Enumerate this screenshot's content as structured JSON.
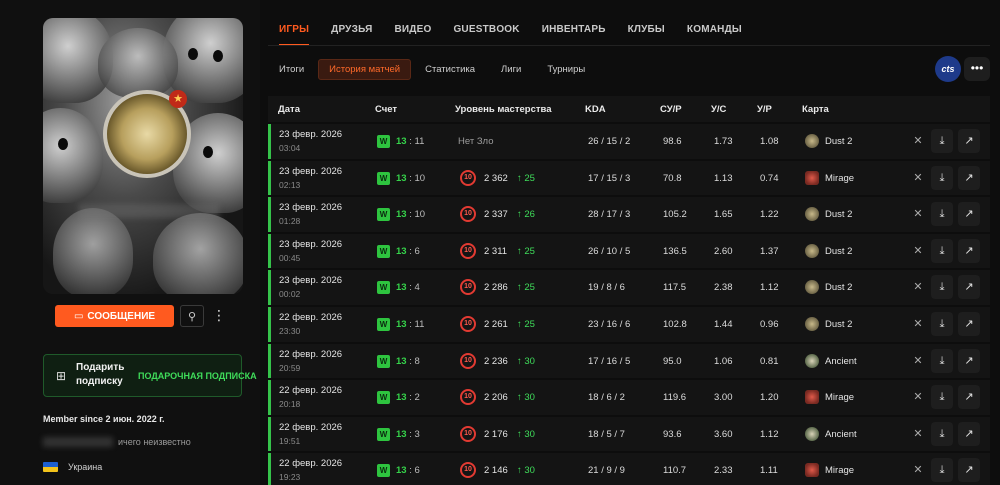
{
  "profile": {
    "message_button": "СООБЩЕНИЕ",
    "gift_title": "Подарить подписку",
    "gift_link": "ПОДАРОЧНАЯ ПОДПИСКА",
    "member_since": "Member since 2 июн. 2022 г.",
    "unknown_text": "ичего неизвестно",
    "country": "Украина"
  },
  "nav": {
    "tabs": [
      "ИГРЫ",
      "ДРУЗЬЯ",
      "ВИДЕО",
      "GUESTBOOK",
      "ИНВЕНТАРЬ",
      "КЛУБЫ",
      "КОМАНДЫ"
    ],
    "active_tab": "ИГРЫ",
    "subtabs": [
      "Итоги",
      "История матчей",
      "Статистика",
      "Лиги",
      "Турниры"
    ],
    "active_subtab": "История матчей",
    "cts_label": "cts",
    "more_label": "•••"
  },
  "table": {
    "headers": {
      "date": "Дата",
      "score": "Счет",
      "skill": "Уровень мастерства",
      "kda": "KDA",
      "adr": "СУ/Р",
      "kr": "У/С",
      "kd": "У/Р",
      "map": "Карта"
    },
    "rows": [
      {
        "date": "23 февр. 2026",
        "time": "03:04",
        "result": "W",
        "score_w": "13",
        "score_l": "11",
        "elo": "",
        "gain": "",
        "elo_text": "Нет Зло",
        "kda": "26 / 15 / 2",
        "adr": "98.6",
        "kr": "1.73",
        "kd": "1.08",
        "map": "Dust 2",
        "map_type": "dust"
      },
      {
        "date": "23 февр. 2026",
        "time": "02:13",
        "result": "W",
        "score_w": "13",
        "score_l": "10",
        "elo": "2 362",
        "gain": "↑ 25",
        "elo_text": "",
        "kda": "17 / 15 / 3",
        "adr": "70.8",
        "kr": "1.13",
        "kd": "0.74",
        "map": "Mirage",
        "map_type": "mirage"
      },
      {
        "date": "23 февр. 2026",
        "time": "01:28",
        "result": "W",
        "score_w": "13",
        "score_l": "10",
        "elo": "2 337",
        "gain": "↑ 26",
        "elo_text": "",
        "kda": "28 / 17 / 3",
        "adr": "105.2",
        "kr": "1.65",
        "kd": "1.22",
        "map": "Dust 2",
        "map_type": "dust"
      },
      {
        "date": "23 февр. 2026",
        "time": "00:45",
        "result": "W",
        "score_w": "13",
        "score_l": "6",
        "elo": "2 311",
        "gain": "↑ 25",
        "elo_text": "",
        "kda": "26 / 10 / 5",
        "adr": "136.5",
        "kr": "2.60",
        "kd": "1.37",
        "map": "Dust 2",
        "map_type": "dust"
      },
      {
        "date": "23 февр. 2026",
        "time": "00:02",
        "result": "W",
        "score_w": "13",
        "score_l": "4",
        "elo": "2 286",
        "gain": "↑ 25",
        "elo_text": "",
        "kda": "19 / 8 / 6",
        "adr": "117.5",
        "kr": "2.38",
        "kd": "1.12",
        "map": "Dust 2",
        "map_type": "dust"
      },
      {
        "date": "22 февр. 2026",
        "time": "23:30",
        "result": "W",
        "score_w": "13",
        "score_l": "11",
        "elo": "2 261",
        "gain": "↑ 25",
        "elo_text": "",
        "kda": "23 / 16 / 6",
        "adr": "102.8",
        "kr": "1.44",
        "kd": "0.96",
        "map": "Dust 2",
        "map_type": "dust"
      },
      {
        "date": "22 февр. 2026",
        "time": "20:59",
        "result": "W",
        "score_w": "13",
        "score_l": "8",
        "elo": "2 236",
        "gain": "↑ 30",
        "elo_text": "",
        "kda": "17 / 16 / 5",
        "adr": "95.0",
        "kr": "1.06",
        "kd": "0.81",
        "map": "Ancient",
        "map_type": "ancient"
      },
      {
        "date": "22 февр. 2026",
        "time": "20:18",
        "result": "W",
        "score_w": "13",
        "score_l": "2",
        "elo": "2 206",
        "gain": "↑ 30",
        "elo_text": "",
        "kda": "18 / 6 / 2",
        "adr": "119.6",
        "kr": "3.00",
        "kd": "1.20",
        "map": "Mirage",
        "map_type": "mirage"
      },
      {
        "date": "22 февр. 2026",
        "time": "19:51",
        "result": "W",
        "score_w": "13",
        "score_l": "3",
        "elo": "2 176",
        "gain": "↑ 30",
        "elo_text": "",
        "kda": "18 / 5 / 7",
        "adr": "93.6",
        "kr": "3.60",
        "kd": "1.12",
        "map": "Ancient",
        "map_type": "ancient"
      },
      {
        "date": "22 февр. 2026",
        "time": "19:23",
        "result": "W",
        "score_w": "13",
        "score_l": "6",
        "elo": "2 146",
        "gain": "↑ 30",
        "elo_text": "",
        "kda": "21 / 9 / 9",
        "adr": "110.7",
        "kr": "2.33",
        "kd": "1.11",
        "map": "Mirage",
        "map_type": "mirage"
      }
    ]
  },
  "colors": {
    "accent": "#ff5a1f",
    "win": "#35c24a",
    "elo_ring": "#e23a32",
    "background": "#0d0d0d"
  },
  "icons": {
    "message": "chat-icon",
    "friend": "add-friend-icon",
    "gift": "gift-icon",
    "compare": "compare-icon",
    "download": "download-icon",
    "external": "external-link-icon"
  }
}
